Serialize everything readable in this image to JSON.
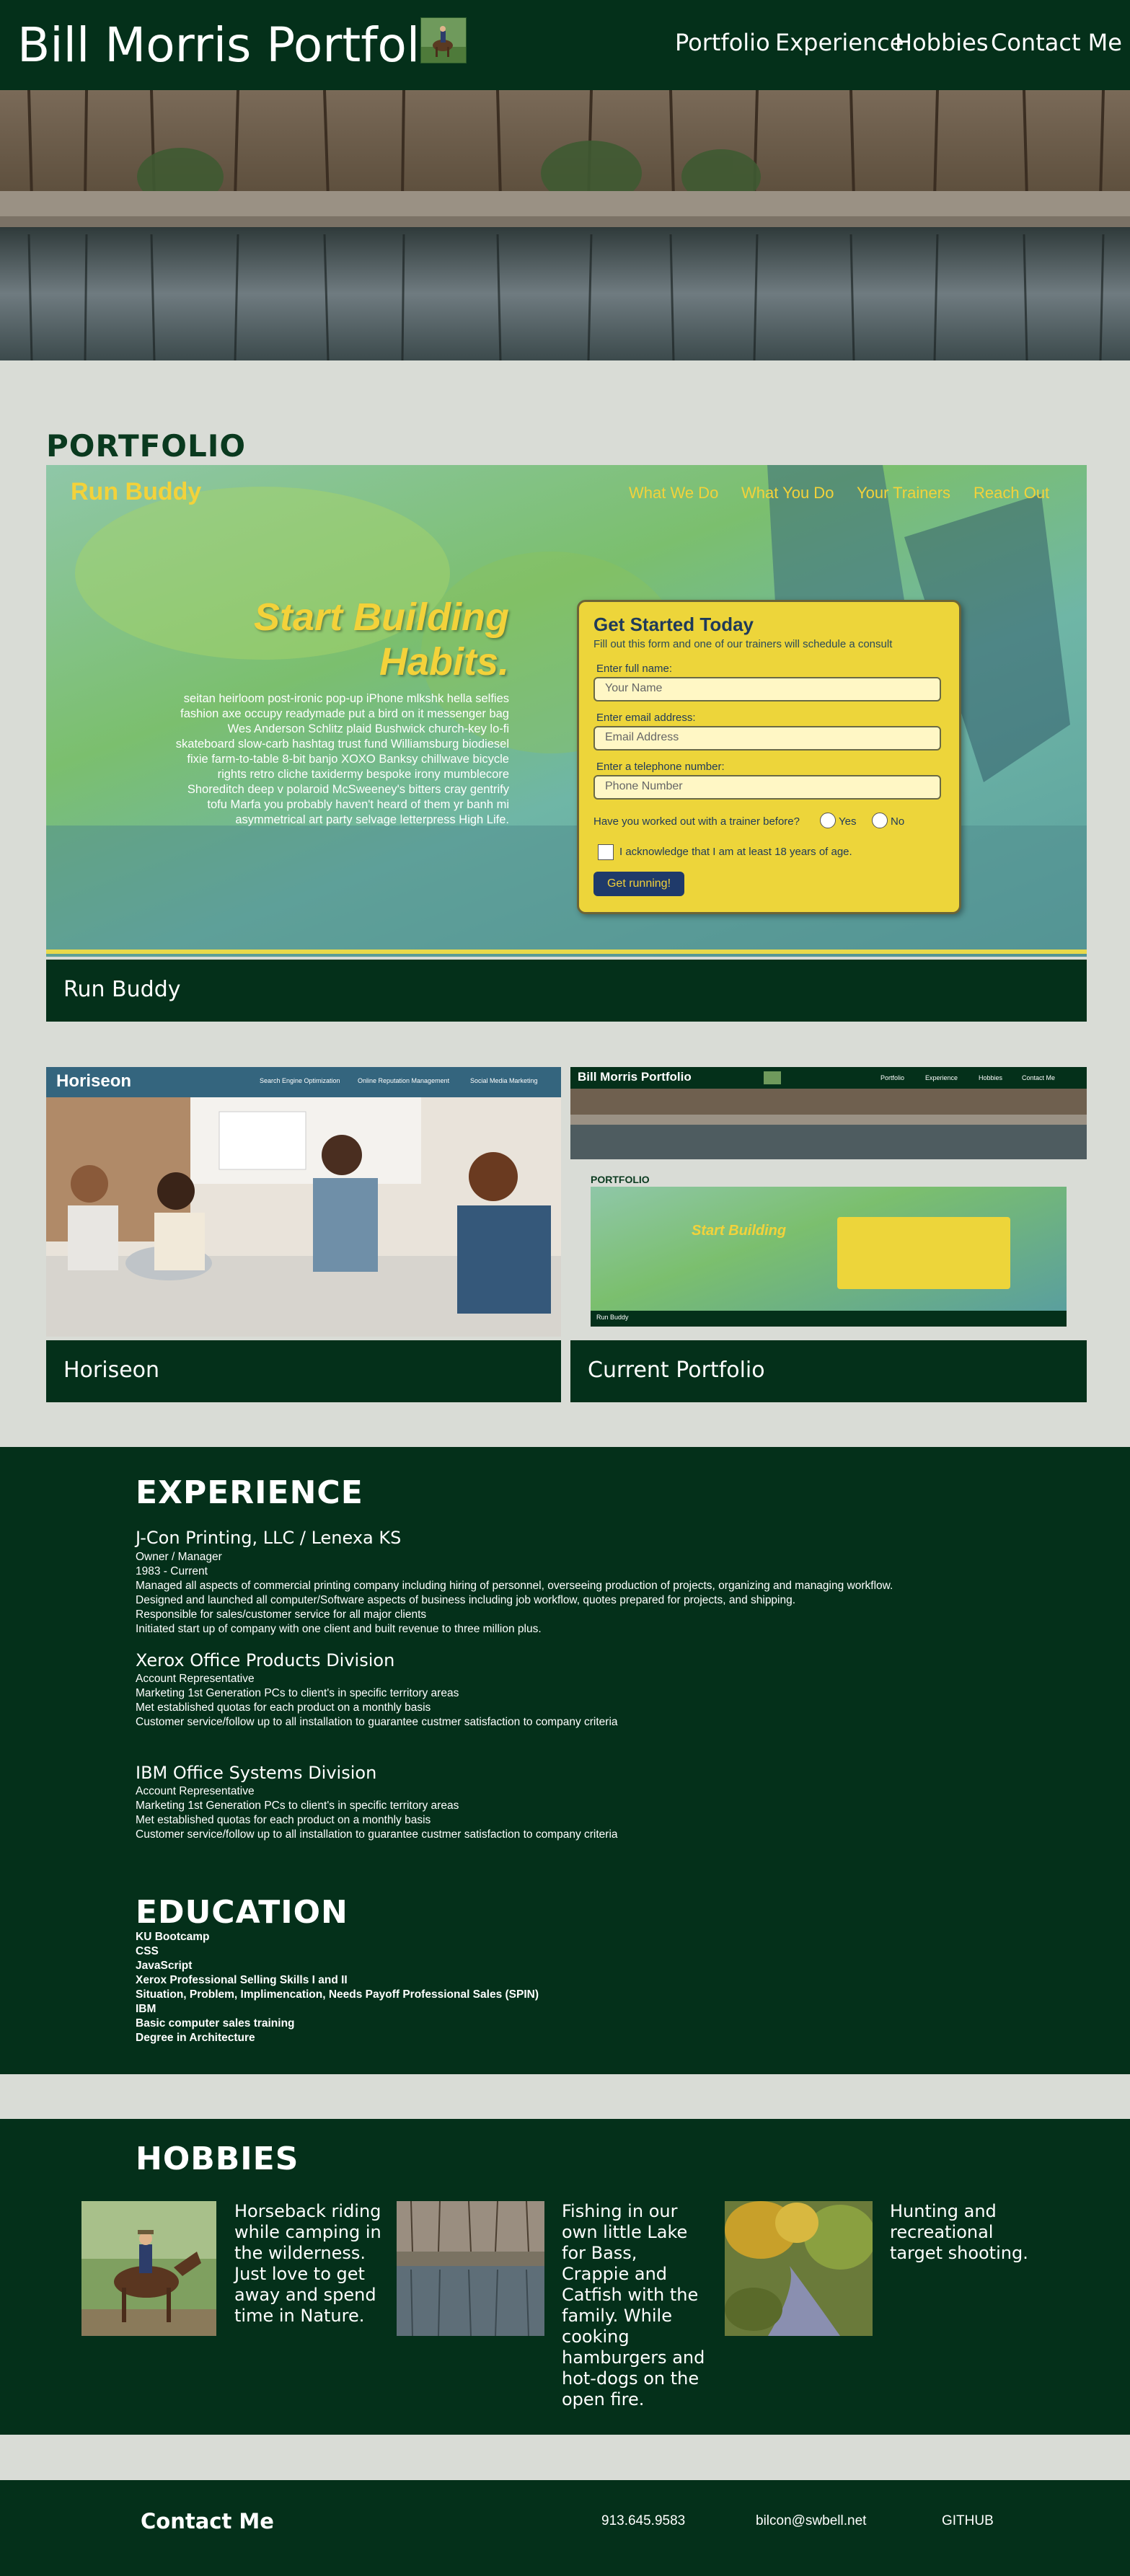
{
  "header": {
    "title": "Bill Morris Portfolio",
    "nav": [
      "Portfolio",
      "Experience",
      "Hobbies",
      "Contact Me"
    ]
  },
  "portfolio": {
    "title": "PORTFOLIO",
    "projects": [
      {
        "caption": "Run Buddy"
      },
      {
        "caption": "Horiseon"
      },
      {
        "caption": "Current Portfolio"
      }
    ]
  },
  "run_buddy_preview": {
    "brand": "Run Buddy",
    "nav": [
      "What We Do",
      "What You Do",
      "Your Trainers",
      "Reach Out"
    ],
    "hero_line1": "Start Building",
    "hero_line2": "Habits.",
    "blurb": "seitan heirloom post-ironic pop-up iPhone mlkshk hella selfies fashion axe occupy readymade put a bird on it messenger bag Wes Anderson Schlitz plaid Bushwick church-key lo-fi skateboard slow-carb hashtag trust fund Williamsburg biodiesel fixie farm-to-table 8-bit banjo XOXO Banksy chillwave bicycle rights retro cliche taxidermy bespoke irony mumblecore Shoreditch deep v polaroid McSweeney's bitters cray gentrify tofu Marfa you probably haven't heard of them yr banh mi asymmetrical art party selvage letterpress High Life.",
    "form_title": "Get Started Today",
    "form_sub": "Fill out this form and one of our trainers will schedule a consult",
    "name_label": "Enter full name:",
    "name_placeholder": "Your Name",
    "email_label": "Enter email address:",
    "email_placeholder": "Email Address",
    "phone_label": "Enter a telephone number:",
    "phone_placeholder": "Phone Number",
    "trainer_q": "Have you worked out with a trainer before?",
    "yes": "Yes",
    "no": "No",
    "ack": "I acknowledge that I am at least 18 years of age.",
    "submit": "Get running!"
  },
  "horiseon_preview": {
    "brand": "Horiseon",
    "nav": [
      "Search Engine Optimization",
      "Online Reputation Management",
      "Social Media Marketing"
    ]
  },
  "portfolio_preview": {
    "title": "Bill Morris Portfolio",
    "nav": [
      "Portfolio",
      "Experience",
      "Hobbies",
      "Contact Me"
    ],
    "section": "PORTFOLIO",
    "caption": "Run Buddy"
  },
  "experience": {
    "title": "EXPERIENCE",
    "jobs": [
      {
        "company": "J-Con Printing, LLC / Lenexa KS",
        "lines": [
          "Owner / Manager",
          "1983 - Current",
          "Managed all aspects of commercial printing company including hiring of personnel, overseeing production of projects, organizing and managing workflow.",
          "Designed and launched all computer/Software aspects of business including job workflow, quotes prepared for projects, and shipping.",
          "Responsible for sales/customer service for all major clients",
          "Initiated start up of company with one client and built revenue to three million plus."
        ]
      },
      {
        "company": "Xerox Office Products Division",
        "lines": [
          "Account Representative",
          "Marketing 1st Generation PCs to client's in specific territory areas",
          "Met established quotas for each product on a monthly basis",
          "Customer service/follow up to all installation to guarantee custmer satisfaction to company criteria"
        ]
      },
      {
        "company": "IBM Office Systems Division",
        "lines": [
          "Account Representative",
          "Marketing 1st Generation PCs to client's in specific territory areas",
          "Met established quotas for each product on a monthly basis",
          "Customer service/follow up to all installation to guarantee custmer satisfaction to company criteria"
        ]
      }
    ]
  },
  "education": {
    "title": "EDUCATION",
    "items": [
      "KU Bootcamp",
      "CSS",
      "JavaScript",
      "Xerox Professional Selling Skills I and II",
      "Situation, Problem, Implimencation, Needs Payoff Professional Sales (SPIN)",
      "IBM",
      "Basic computer sales training",
      "Degree in Architecture"
    ]
  },
  "hobbies": {
    "title": "HOBBIES",
    "items": [
      {
        "text": "Horseback riding while camping in the wilderness. Just love to get away and spend time in Nature."
      },
      {
        "text": "Fishing in our own little Lake for Bass, Crappie and Catfish with the family. While cooking hamburgers and hot-dogs on the open fire."
      },
      {
        "text": "Hunting and recreational target shooting."
      }
    ]
  },
  "footer": {
    "title": "Contact Me",
    "phone": "913.645.9583",
    "email": "bilcon@swbell.net",
    "github": "GITHUB"
  },
  "colors": {
    "primary": "#04301a",
    "background": "#d9dcd6",
    "run_buddy_yellow": "#f3d23a"
  }
}
